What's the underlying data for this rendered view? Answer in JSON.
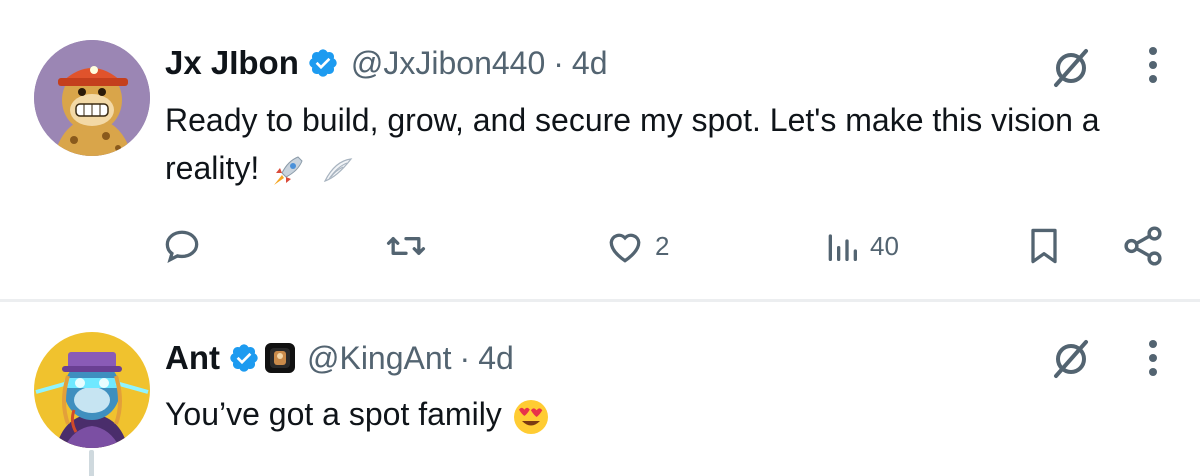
{
  "posts": [
    {
      "author_name": "Jx JIbon",
      "handle": "@JxJibon440",
      "separator": "·",
      "time": "4d",
      "text": "Ready to build, grow, and secure my spot. Let's make this vision a reality!",
      "emojis": [
        "rocket-emoji",
        "wing-emoji"
      ],
      "avatar": "ape-avatar-orange-cap",
      "actions": {
        "reply_count": "",
        "retweet_count": "",
        "like_count": "2",
        "views_count": "40"
      }
    },
    {
      "author_name": "Ant",
      "handle": "@KingAnt",
      "separator": "·",
      "time": "4d",
      "text": "You’ve got a spot family",
      "emojis": [
        "heart-eyes-emoji"
      ],
      "avatar": "ape-avatar-laser-eyes"
    }
  ],
  "colors": {
    "verified": "#1d9bf0",
    "secondary_text": "#536471",
    "divider": "#eceef0"
  }
}
